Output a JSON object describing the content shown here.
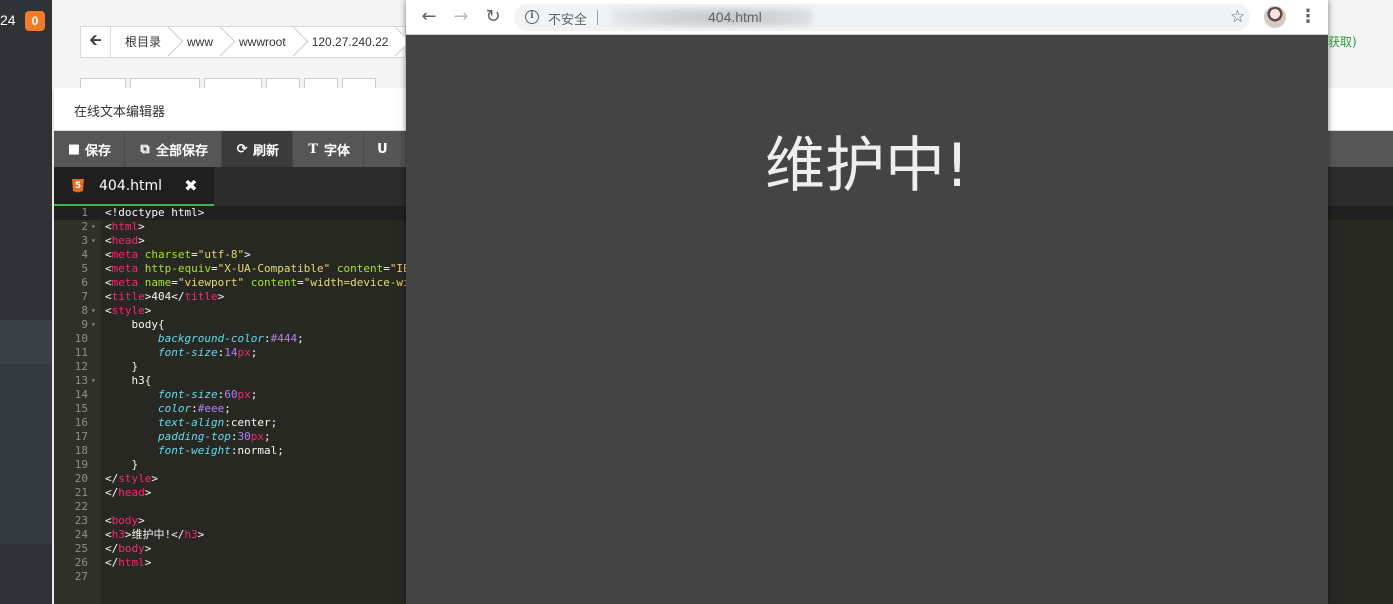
{
  "sidebar": {
    "number": "24",
    "badge": "0"
  },
  "file_manager": {
    "breadcrumbs": [
      "根目录",
      "www",
      "wwwroot",
      "120.27.240.22"
    ],
    "right_text": "获取)"
  },
  "editor": {
    "title": "在线文本编辑器",
    "toolbar": [
      {
        "label": "保存",
        "icon": "save-icon"
      },
      {
        "label": "全部保存",
        "icon": "save-all-icon"
      },
      {
        "label": "刷新",
        "icon": "refresh-icon"
      },
      {
        "label": "字体",
        "icon": "font-icon"
      },
      {
        "label": "U",
        "icon": "underline-icon"
      }
    ],
    "active_toolbar_index": 2,
    "tab": {
      "name": "404.html",
      "icon": "html5-file-icon"
    },
    "code_lines": [
      "<!doctype html>",
      "<html>",
      "<head>",
      "<meta charset=\"utf-8\">",
      "<meta http-equiv=\"X-UA-Compatible\" content=\"IE",
      "<meta name=\"viewport\" content=\"width=device-wi",
      "<title>404</title>",
      "<style>",
      "    body{",
      "        background-color:#444;",
      "        font-size:14px;",
      "    }",
      "    h3{",
      "        font-size:60px;",
      "        color:#eee;",
      "        text-align:center;",
      "        padding-top:30px;",
      "        font-weight:normal;",
      "    }",
      "</style>",
      "</head>",
      "",
      "<body>",
      "<h3>维护中!</h3>",
      "</body>",
      "</html>",
      ""
    ],
    "fold_lines": [
      2,
      3,
      8,
      9,
      13
    ]
  },
  "browser": {
    "security_label": "不安全",
    "url_path": "404.html",
    "page_heading": "维护中!",
    "page_background": "#444444",
    "heading_color": "#eeeeee"
  }
}
